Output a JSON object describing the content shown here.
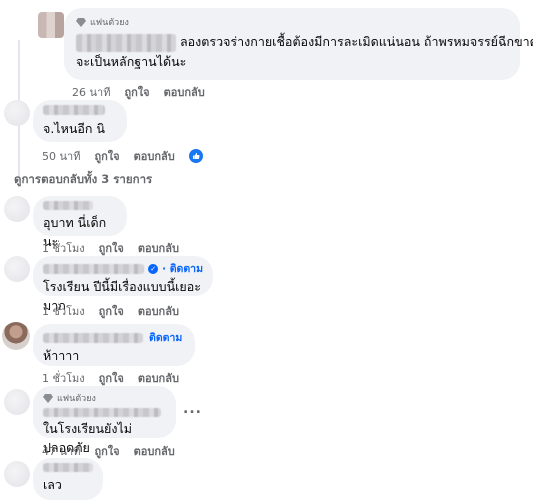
{
  "comments": [
    {
      "badge": "แฟนตัวยง",
      "text_line1": "ลองตรวจร่างกายเชื้อต้องมีการละเมิดแน่นอน ถ้าพรหมจรรย์ฉีกขาดน่า",
      "text_line2": "จะเป็นหลักฐานได้นะ",
      "time": "26 นาที",
      "like": "ถูกใจ",
      "reply": "ตอบกลับ"
    },
    {
      "text": "จ.ไหนอีก นิ",
      "time": "50 นาที",
      "like": "ถูกใจ",
      "reply": "ตอบกลับ"
    },
    {
      "text": "อุบาท นี่เด็กนะ",
      "time": "1 ชั่วโมง",
      "like": "ถูกใจ",
      "reply": "ตอบกลับ"
    },
    {
      "follow": "· ติดตาม",
      "text": "โรงเรียน ปีนี้มีเรื่องแบบนี้เยอะมาก",
      "time": "1 ชั่วโมง",
      "like": "ถูกใจ",
      "reply": "ตอบกลับ"
    },
    {
      "follow": "ติดตาม",
      "text": "ห้าาาา",
      "time": "1 ชั่วโมง",
      "like": "ถูกใจ",
      "reply": "ตอบกลับ"
    },
    {
      "badge": "แฟนตัวยง",
      "text": "ในโรงเรียนยังไม่ปลอดภัย",
      "time": "47 นาที",
      "like": "ถูกใจ",
      "reply": "ตอบกลับ"
    },
    {
      "text": "เลว"
    }
  ],
  "view_replies": "ดูการตอบกลับทั้ง 3 รายการ",
  "more": "...",
  "colors": {
    "bubble": "#f0f2f5",
    "link": "#0866ff",
    "meta": "#65676b",
    "like_badge": "#1877f2"
  }
}
